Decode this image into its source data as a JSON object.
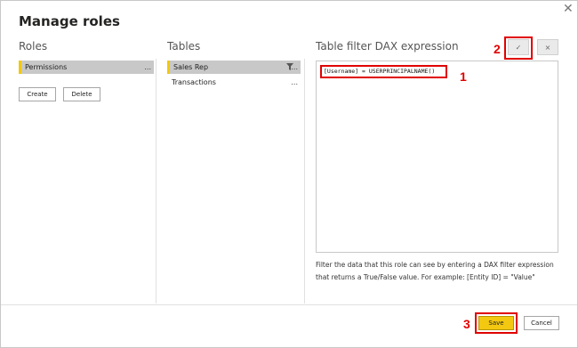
{
  "dialog": {
    "title": "Manage roles"
  },
  "roles": {
    "header": "Roles",
    "items": [
      {
        "label": "Permissions",
        "more": "..."
      }
    ],
    "create_label": "Create",
    "delete_label": "Delete"
  },
  "tables": {
    "header": "Tables",
    "items": [
      {
        "label": "Sales Rep",
        "more": "..."
      },
      {
        "label": "Transactions",
        "more": "..."
      }
    ]
  },
  "dax": {
    "header": "Table filter DAX expression",
    "expression": "[Username] = USERPRINCIPALNAME()",
    "confirm_icon": "✓",
    "cancel_icon": "×",
    "help_text": "Filter the data that this role can see by entering a DAX filter expression that returns a True/False value. For example: [Entity ID] = \"Value\""
  },
  "annotations": {
    "one": "1",
    "two": "2",
    "three": "3"
  },
  "footer": {
    "save_label": "Save",
    "cancel_label": "Cancel"
  },
  "colors": {
    "accent": "#f2c811",
    "highlight": "#e00000",
    "selected_bg": "#c8c8c8"
  }
}
